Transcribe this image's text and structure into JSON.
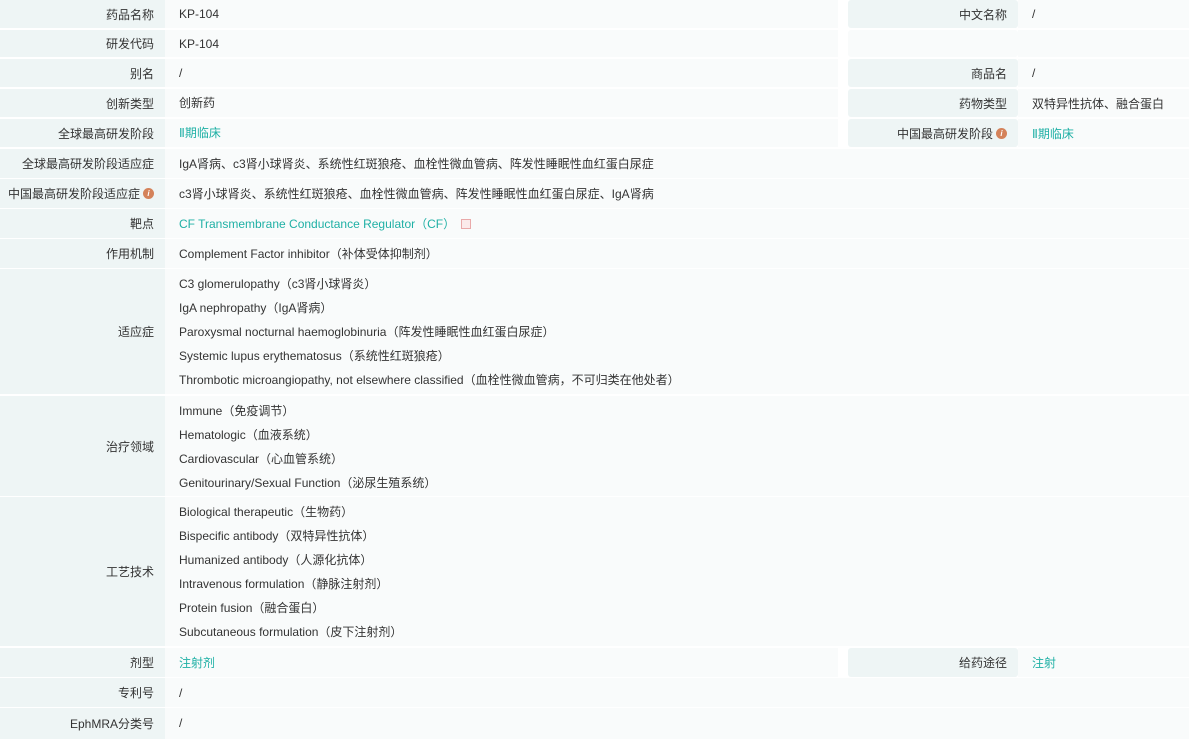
{
  "rows": [
    {
      "label": "药品名称",
      "values": [
        "KP-104"
      ],
      "right": {
        "label": "中文名称",
        "values": [
          "/"
        ]
      }
    },
    {
      "label": "研发代码",
      "values": [
        "KP-104"
      ],
      "right": {
        "label": "",
        "values": []
      }
    },
    {
      "label": "别名",
      "values": [
        "/"
      ],
      "right": {
        "label": "商品名",
        "values": [
          "/"
        ]
      }
    },
    {
      "label": "创新类型",
      "values": [
        "创新药"
      ],
      "right": {
        "label": "药物类型",
        "values": [
          "双特异性抗体、融合蛋白"
        ]
      }
    },
    {
      "label": "全球最高研发阶段",
      "values": [
        "Ⅱ期临床"
      ],
      "link": true,
      "right": {
        "label": "中国最高研发阶段",
        "info": true,
        "link": true,
        "values": [
          "Ⅱ期临床"
        ]
      }
    },
    {
      "label": "全球最高研发阶段适应症",
      "values": [
        "IgA肾病、c3肾小球肾炎、系统性红斑狼疮、血栓性微血管病、阵发性睡眠性血红蛋白尿症"
      ]
    },
    {
      "label": "中国最高研发阶段适应症",
      "info": true,
      "values": [
        "c3肾小球肾炎、系统性红斑狼疮、血栓性微血管病、阵发性睡眠性血红蛋白尿症、IgA肾病"
      ]
    },
    {
      "label": "靶点",
      "values": [
        "CF Transmembrane Conductance Regulator（CF）"
      ],
      "link": true,
      "ext": true
    },
    {
      "label": "作用机制",
      "values": [
        "Complement Factor inhibitor（补体受体抑制剂）"
      ]
    },
    {
      "label": "适应症",
      "values": [
        "C3 glomerulopathy（c3肾小球肾炎）",
        "IgA nephropathy（IgA肾病）",
        "Paroxysmal nocturnal haemoglobinuria（阵发性睡眠性血红蛋白尿症）",
        "Systemic lupus erythematosus（系统性红斑狼疮）",
        "Thrombotic microangiopathy, not elsewhere classified（血栓性微血管病，不可归类在他处者）"
      ]
    },
    {
      "label": "治疗领域",
      "values": [
        "Immune（免疫调节）",
        "Hematologic（血液系统）",
        "Cardiovascular（心血管系统）",
        "Genitourinary/Sexual Function（泌尿生殖系统）"
      ]
    },
    {
      "label": "工艺技术",
      "values": [
        "Biological therapeutic（生物药）",
        "Bispecific antibody（双特异性抗体）",
        "Humanized antibody（人源化抗体）",
        "Intravenous formulation（静脉注射剂）",
        "Protein fusion（融合蛋白）",
        "Subcutaneous formulation（皮下注射剂）"
      ]
    },
    {
      "label": "剂型",
      "values": [
        "注射剂"
      ],
      "link": true,
      "right": {
        "label": "给药途径",
        "link": true,
        "values": [
          "注射"
        ]
      }
    },
    {
      "label": "专利号",
      "values": [
        "/"
      ]
    },
    {
      "label": "EphMRA分类号",
      "values": [
        "/"
      ]
    }
  ],
  "colors": {
    "link": "#1fb0a5",
    "info": "#d4825a",
    "label_bg": "#eef5f5",
    "value_bg": "#f9fbfb"
  }
}
